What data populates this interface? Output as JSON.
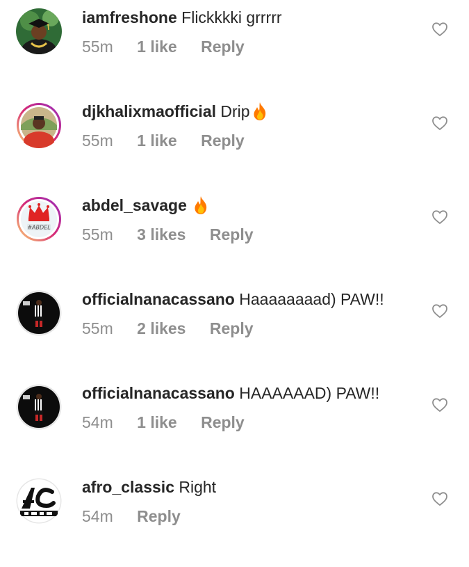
{
  "comments": [
    {
      "username": "iamfreshone",
      "text": "Flickkkki grrrrr",
      "time": "55m",
      "likes": "1 like",
      "reply": "Reply",
      "emoji": "",
      "avatar_icon": "avatar-graduate-icon"
    },
    {
      "username": "djkhalixmaofficial",
      "text": "Drip",
      "time": "55m",
      "likes": "1 like",
      "reply": "Reply",
      "emoji": "fire-emoji-icon",
      "avatar_icon": "avatar-man-red-icon"
    },
    {
      "username": "abdel_savage",
      "text": "",
      "time": "55m",
      "likes": "3 likes",
      "reply": "Reply",
      "emoji": "fire-emoji-icon",
      "avatar_icon": "avatar-crown-logo-icon"
    },
    {
      "username": "officialnanacassano",
      "text": "Haaaaaaaad) PAW!!",
      "time": "55m",
      "likes": "2 likes",
      "reply": "Reply",
      "emoji": "",
      "avatar_icon": "avatar-footballer-icon"
    },
    {
      "username": "officialnanacassano",
      "text": "HAAAAAAD) PAW!!",
      "time": "54m",
      "likes": "1 like",
      "reply": "Reply",
      "emoji": "",
      "avatar_icon": "avatar-footballer-icon"
    },
    {
      "username": "afro_classic",
      "text": "Right",
      "time": "54m",
      "likes": "",
      "reply": "Reply",
      "emoji": "",
      "avatar_icon": "avatar-ac-logo-icon"
    }
  ],
  "colors": {
    "text_primary": "#262626",
    "text_secondary": "#8e8e8e",
    "story_ring_gradient": [
      "#feda75",
      "#d62976",
      "#962fbf"
    ],
    "fire": "#ff6d00"
  }
}
